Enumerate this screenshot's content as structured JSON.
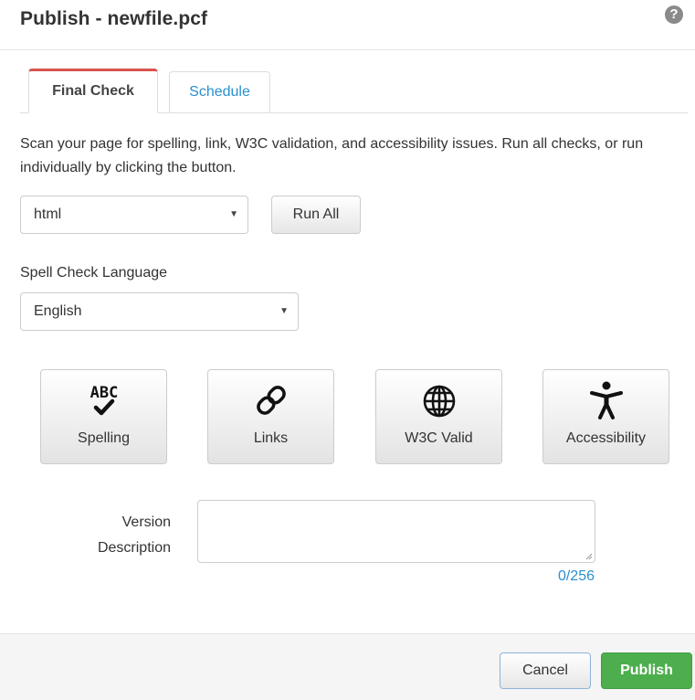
{
  "dialog": {
    "title": "Publish - newfile.pcf",
    "help_icon": "question-circle-icon"
  },
  "tabs": [
    {
      "label": "Final Check",
      "active": true
    },
    {
      "label": "Schedule",
      "active": false
    }
  ],
  "final_check": {
    "description": "Scan your page for spelling, link, W3C validation, and accessibility issues. Run all checks, or run individually by clicking the button.",
    "doctype_select": {
      "value": "html"
    },
    "run_all_label": "Run All",
    "spell_language_label": "Spell Check Language",
    "spell_language_select": {
      "value": "English"
    },
    "checks": [
      {
        "label": "Spelling",
        "icon": "abc-check-icon"
      },
      {
        "label": "Links",
        "icon": "link-icon"
      },
      {
        "label": "W3C Valid",
        "icon": "globe-icon"
      },
      {
        "label": "Accessibility",
        "icon": "accessibility-icon"
      }
    ],
    "version_description_label_line1": "Version",
    "version_description_label_line2": "Description",
    "version_description_value": "",
    "char_counter": "0/256"
  },
  "footer": {
    "cancel_label": "Cancel",
    "publish_label": "Publish"
  },
  "colors": {
    "active_tab_accent": "#d9534f",
    "link_blue": "#2a8fcf",
    "publish_green": "#4cae4c"
  }
}
